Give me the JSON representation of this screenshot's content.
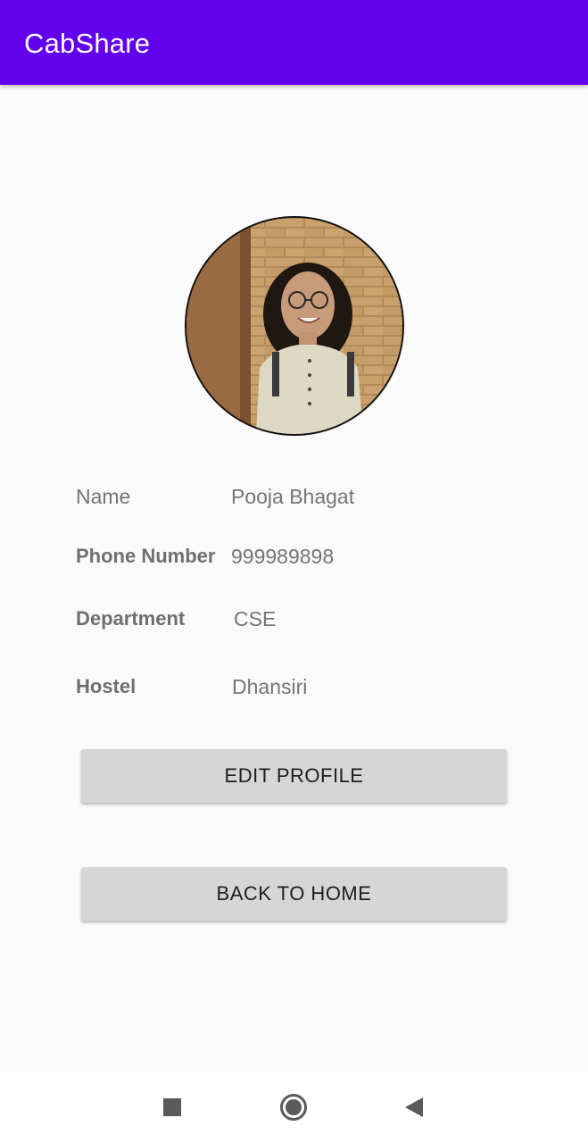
{
  "app": {
    "title": "CabShare",
    "accent_color": "#6200ee"
  },
  "profile": {
    "avatar_icon": "profile-photo",
    "fields": [
      {
        "label": "Name",
        "value": "Pooja Bhagat"
      },
      {
        "label": "Phone Number",
        "value": "999989898"
      },
      {
        "label": "Department",
        "value": "CSE"
      },
      {
        "label": "Hostel",
        "value": "Dhansiri"
      }
    ]
  },
  "actions": {
    "edit_profile": "EDIT PROFILE",
    "back_to_home": "BACK TO HOME"
  },
  "system_nav": {
    "recents_icon": "square-icon",
    "home_icon": "circle-icon",
    "back_icon": "triangle-back-icon"
  }
}
